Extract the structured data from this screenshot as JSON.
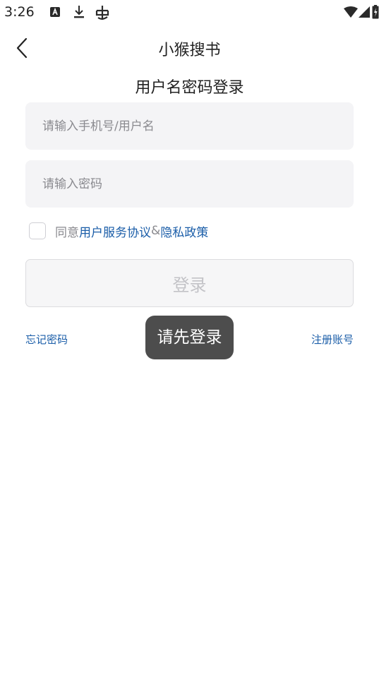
{
  "status_bar": {
    "time": "3:26",
    "left_icons": [
      "a-box-icon",
      "download-icon",
      "bug-icon"
    ],
    "right_icons": [
      "wifi-icon",
      "signal-icon",
      "battery-charging-icon"
    ]
  },
  "nav": {
    "back_icon": "chevron-left-icon",
    "title": "小猴搜书"
  },
  "login": {
    "heading": "用户名密码登录",
    "username_placeholder": "请输入手机号/用户名",
    "password_placeholder": "请输入密码",
    "agree_prefix": "同意",
    "terms_link": "用户服务协议",
    "ampersand": "&",
    "privacy_link": "隐私政策",
    "submit_label": "登录",
    "forgot_password": "忘记密码",
    "register": "注册账号"
  },
  "toast": {
    "message": "请先登录"
  },
  "colors": {
    "link": "#1a5da8",
    "field_bg": "#f4f4f6",
    "toast_bg": "#4d4d4d",
    "button_text_disabled": "#c3c3c7"
  }
}
